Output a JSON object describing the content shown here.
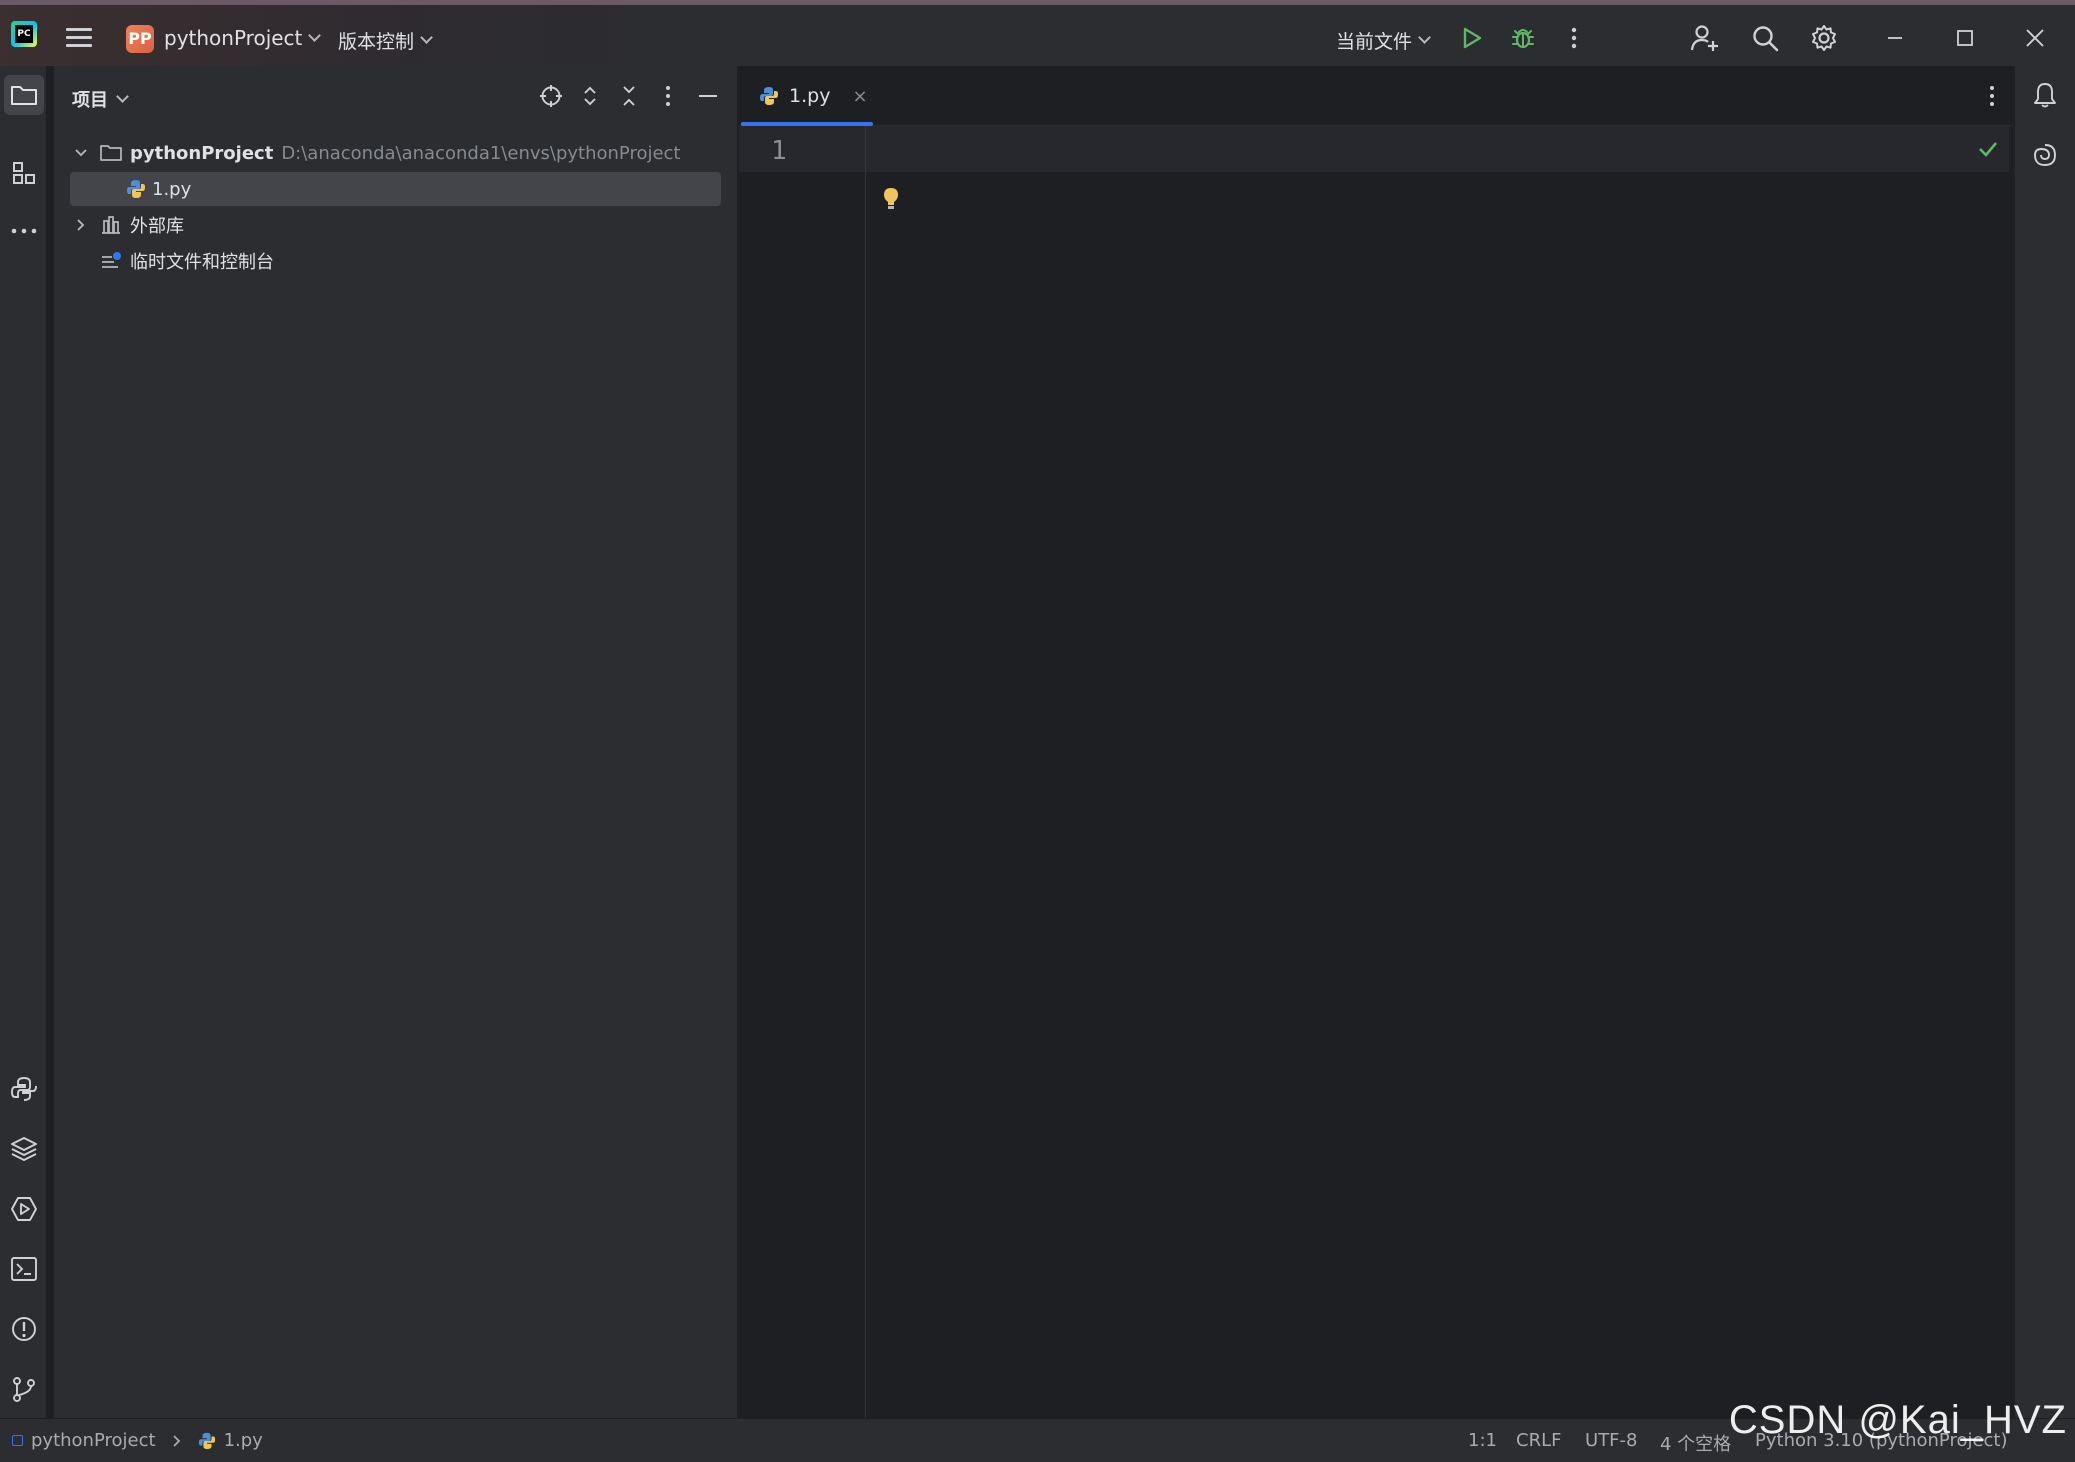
{
  "titlebar": {
    "app_logo": "PC",
    "menu_icon": "hamburger-icon",
    "project_badge": "PP",
    "project_name": "pythonProject",
    "vcs_label": "版本控制",
    "run_config": "当前文件",
    "icons": [
      "run-icon",
      "debug-icon",
      "more-vertical-icon",
      "add-user-icon",
      "search-icon",
      "gear-icon",
      "minimize-icon",
      "maximize-icon",
      "close-icon"
    ]
  },
  "left_strip": {
    "top": [
      "folder-icon",
      "structure-icon",
      "more-horizontal-icon"
    ],
    "bottom": [
      "python-console-icon",
      "layers-icon",
      "services-icon",
      "terminal-icon",
      "problems-icon",
      "git-branch-icon"
    ]
  },
  "project_panel": {
    "title": "项目",
    "header_icons": [
      "locate-icon",
      "expand-all-icon",
      "collapse-all-icon",
      "more-vertical-icon",
      "hide-icon"
    ],
    "tree": [
      {
        "label": "pythonProject",
        "path": "D:\\anaconda\\anaconda1\\envs\\pythonProject",
        "icon": "folder-icon",
        "expanded": true
      },
      {
        "label": "1.py",
        "icon": "python-file-icon",
        "selected": true
      },
      {
        "label": "外部库",
        "icon": "library-icon",
        "expanded": false
      },
      {
        "label": "临时文件和控制台",
        "icon": "scratches-icon"
      }
    ]
  },
  "editor": {
    "tab_label": "1.py",
    "tab_close": "×",
    "line_number": "1",
    "inspection": "check-icon",
    "bulb": "lightbulb-icon"
  },
  "right_strip": [
    "bell-icon",
    "ai-assistant-icon"
  ],
  "statusbar": {
    "breadcrumb_project": "pythonProject",
    "breadcrumb_file": "1.py",
    "position": "1:1",
    "line_sep": "CRLF",
    "encoding": "UTF-8",
    "indent": "4 个空格",
    "interpreter": "Python 3.10 (pythonProject)"
  },
  "watermark": "CSDN @Kai_HVZ",
  "colors": {
    "accent": "#3574f0",
    "run_green": "#5fb865",
    "bulb_yellow": "#f2c55c",
    "badge_orange": "#e8714a"
  }
}
